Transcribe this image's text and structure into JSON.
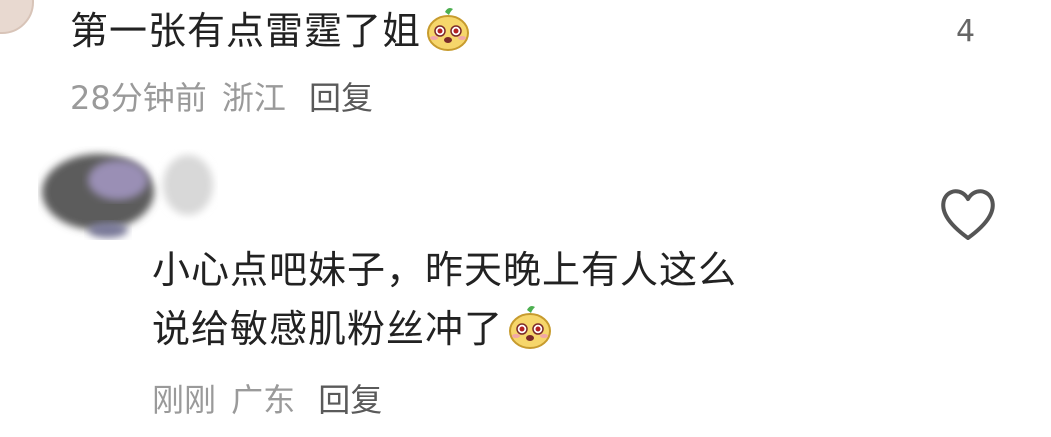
{
  "comments": [
    {
      "text": "第一张有点雷霆了姐",
      "emoji_icon": "pear-emoji-icon",
      "time": "28分钟前",
      "location": "浙江",
      "reply_label": "回复",
      "like_count": "4"
    },
    {
      "text_line1": "小心点吧妹子，昨天晚上有人这么",
      "text_line2": "说给敏感肌粉丝冲了",
      "emoji_icon": "pear-emoji-icon",
      "time": "刚刚",
      "location": "广东",
      "reply_label": "回复",
      "like_icon": "heart-outline-icon"
    }
  ]
}
